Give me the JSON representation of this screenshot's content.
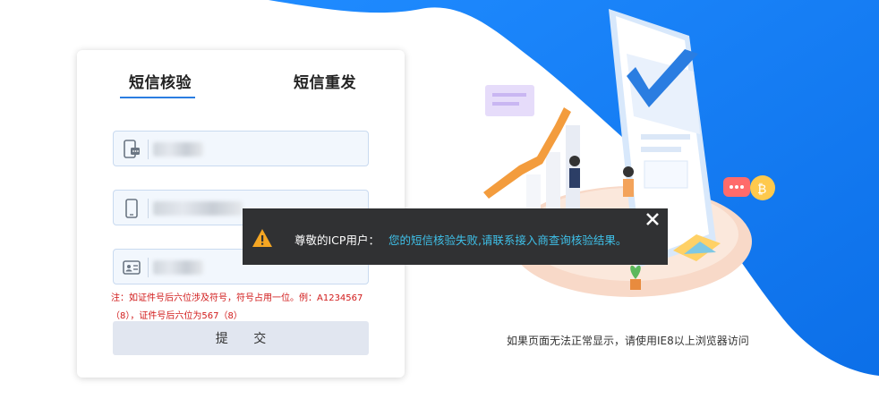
{
  "tabs": [
    {
      "label": "短信核验",
      "active": true
    },
    {
      "label": "短信重发",
      "active": false
    }
  ],
  "note": "注：如证件号后六位涉及符号，符号占用一位。例：A1234567（8），证件号后六位为567（8）",
  "submit_label": "提 交",
  "browser_tip": "如果页面无法正常显示，请使用IE8以上浏览器访问",
  "toast": {
    "title": "尊敬的ICP用户：",
    "message": "您的短信核验失败,请联系接入商查询核验结果。"
  },
  "colors": {
    "accent": "#2a7de1",
    "wave": "#1a7ff0",
    "toast_bg": "#303133",
    "toast_text": "#3fc0e8",
    "warn": "#f5a623",
    "note": "#d11a1a"
  },
  "icons": {
    "field1": "sms-phone-icon",
    "field2": "mobile-phone-icon",
    "field3": "id-card-icon",
    "warning": "warning-icon",
    "close": "close-icon"
  }
}
